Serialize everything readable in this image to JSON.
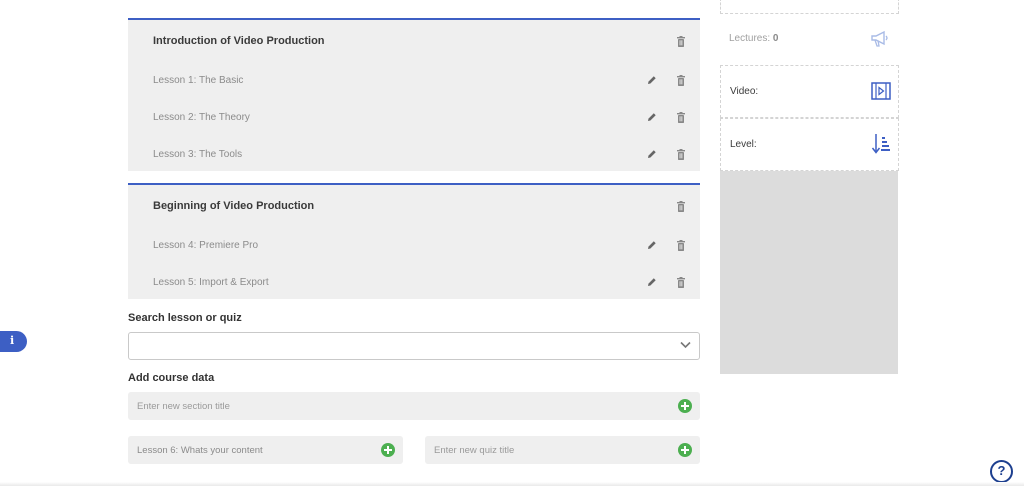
{
  "sections": [
    {
      "title": "Introduction of Video Production",
      "lessons": [
        "Lesson 1: The Basic",
        "Lesson 2: The Theory",
        "Lesson 3: The Tools"
      ]
    },
    {
      "title": "Beginning of Video Production",
      "lessons": [
        "Lesson 4: Premiere Pro",
        "Lesson 5: Import & Export"
      ]
    }
  ],
  "search": {
    "label": "Search lesson or quiz",
    "value": ""
  },
  "add_course": {
    "label": "Add course data",
    "section_placeholder": "Enter new section title",
    "lesson_value": "Lesson 6: Whats your content",
    "quiz_placeholder": "Enter new quiz title"
  },
  "sidebar": {
    "lectures_label": "Lectures:",
    "lectures_count": "0",
    "video_label": "Video:",
    "level_label": "Level:"
  },
  "colors": {
    "accent": "#3d5fc4",
    "add_green": "#4caf50",
    "help": "#1d3f8f"
  },
  "icons": [
    "trash-icon",
    "pencil-icon",
    "chevron-down-icon",
    "plus-circle-icon",
    "megaphone-icon",
    "video-icon",
    "sort-level-icon",
    "info-icon",
    "help-icon"
  ]
}
